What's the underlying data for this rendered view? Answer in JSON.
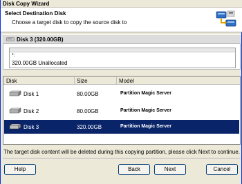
{
  "window": {
    "title": "Disk Copy Wizard"
  },
  "header": {
    "title": "Select Destination Disk",
    "subtitle": "Choose a target disk to copy the source disk to"
  },
  "disk_bar": {
    "label": "Disk 3 (320.00GB)"
  },
  "partition": {
    "marker": "*:",
    "description": "320.00GB Unallocated"
  },
  "table": {
    "columns": [
      "Disk",
      "Size",
      "Model"
    ],
    "rows": [
      {
        "disk": "Disk 1",
        "size": "80.00GB",
        "model": "Partition Magic Server",
        "selected": false
      },
      {
        "disk": "Disk 2",
        "size": "80.00GB",
        "model": "Partition Magic Server",
        "selected": false
      },
      {
        "disk": "Disk 3",
        "size": "320.00GB",
        "model": "Partition Magic Server",
        "selected": true
      }
    ]
  },
  "hint": "The target disk content will be deleted during this copying partition, please click Next to continue.",
  "buttons": {
    "help": "Help",
    "back": "Back",
    "next": "Next",
    "cancel": "Cancel"
  },
  "colors": {
    "selection": "#0a246a",
    "header_bg": "#ffffff",
    "dialog_bg": "#ece9d8"
  },
  "icons": {
    "wizard": "disk-copy-wizard-icon",
    "disk": "hard-disk-icon"
  }
}
